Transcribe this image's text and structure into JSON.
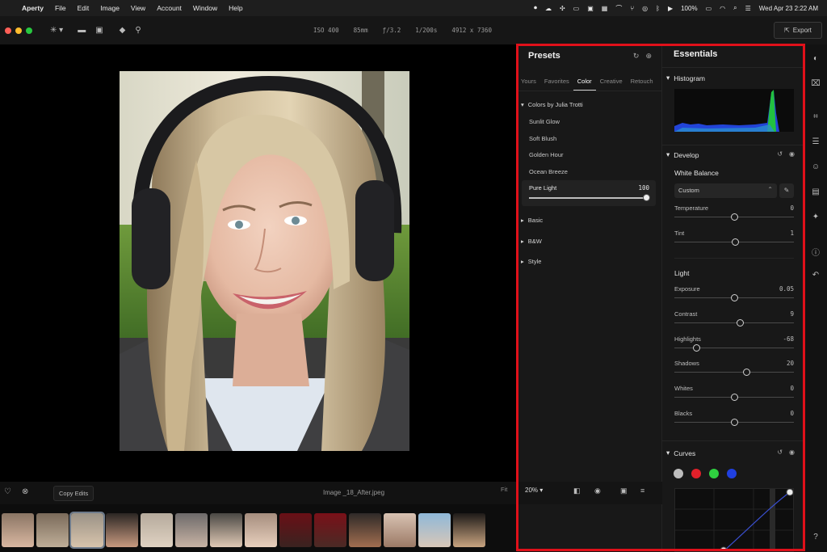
{
  "menubar": {
    "app": "Aperty",
    "items": [
      "File",
      "Edit",
      "Image",
      "View",
      "Account",
      "Window",
      "Help"
    ],
    "battery": "100%",
    "datetime": "Wed Apr 23  2:22 AM"
  },
  "toolbar": {
    "iso": "ISO 400",
    "focal": "85mm",
    "aperture": "ƒ/3.2",
    "shutter": "1/200s",
    "dimensions": "4912 x 7360",
    "export_label": "Export"
  },
  "bottombar": {
    "copy_edits": "Copy Edits",
    "filename": "Image _18_After.jpeg",
    "fit": "Fit",
    "zoom": "20%"
  },
  "presets": {
    "title": "Presets",
    "tabs": [
      "Yours",
      "Favorites",
      "Color",
      "Creative",
      "Retouch"
    ],
    "active_tab": "Color",
    "group_open": "Colors by Julia Trotti",
    "items": [
      "Sunlit Glow",
      "Soft Blush",
      "Golden Hour",
      "Ocean Breeze"
    ],
    "selected": {
      "label": "Pure Light",
      "value": "100",
      "amount": 1.0
    },
    "groups_closed": [
      "Basic",
      "B&W",
      "Style"
    ]
  },
  "essentials": {
    "title": "Essentials",
    "histogram": "Histogram",
    "develop": "Develop",
    "white_balance": "White Balance",
    "wb_mode": "Custom",
    "wb_sliders": [
      {
        "label": "Temperature",
        "value": "0",
        "pos": 0.5
      },
      {
        "label": "Tint",
        "value": "1",
        "pos": 0.51
      }
    ],
    "light": "Light",
    "light_sliders": [
      {
        "label": "Exposure",
        "value": "0.05",
        "pos": 0.5
      },
      {
        "label": "Contrast",
        "value": "9",
        "pos": 0.55
      },
      {
        "label": "Highlights",
        "value": "-68",
        "pos": 0.18
      },
      {
        "label": "Shadows",
        "value": "20",
        "pos": 0.6
      },
      {
        "label": "Whites",
        "value": "0",
        "pos": 0.5
      },
      {
        "label": "Blacks",
        "value": "0",
        "pos": 0.5
      }
    ],
    "curves": "Curves",
    "channel_colors": [
      "#bdbdbd",
      "#e0202a",
      "#2fd040",
      "#2040e0"
    ]
  },
  "colors": {
    "highlight": "#e0101a",
    "traffic": [
      "#ff5f57",
      "#febc2e",
      "#28c840"
    ]
  }
}
